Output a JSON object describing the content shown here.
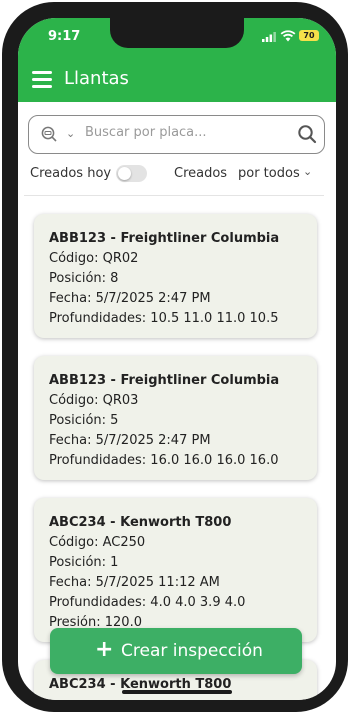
{
  "status": {
    "time": "9:17",
    "battery": "70"
  },
  "appbar": {
    "title": "Llantas",
    "menu_icon": "hamburger-menu-icon"
  },
  "search": {
    "placeholder": "Buscar por placa...",
    "scan_icon": "scan-plate-icon",
    "search_icon": "magnifier-icon"
  },
  "filters": {
    "today_label": "Creados hoy",
    "today_toggle_on": false,
    "created_label": "Creados",
    "created_value": "por todos"
  },
  "cards": [
    {
      "title": "ABB123 - Freightliner Columbia",
      "code": "Código: QR02",
      "position": "Posición: 8",
      "date": "Fecha: 5/7/2025 2:47 PM",
      "depths": "Profundidades: 10.5 11.0 11.0 10.5"
    },
    {
      "title": "ABB123 - Freightliner Columbia",
      "code": "Código: QR03",
      "position": "Posición: 5",
      "date": "Fecha: 5/7/2025 2:47 PM",
      "depths": "Profundidades: 16.0 16.0 16.0 16.0"
    },
    {
      "title": "ABC234 - Kenworth T800",
      "code": "Código: AC250",
      "position": "Posición: 1",
      "date": "Fecha: 5/7/2025 11:12 AM",
      "depths": "Profundidades: 4.0 4.0 3.9 4.0",
      "pressure": "Presión: 120.0"
    },
    {
      "title": "ABC234 - Kenworth T800"
    }
  ],
  "fab": {
    "label": "Crear inspección",
    "icon": "plus-icon"
  },
  "colors": {
    "primary": "#2cb34a",
    "fab": "#3daf65",
    "card_bg": "#f0f2ea"
  }
}
